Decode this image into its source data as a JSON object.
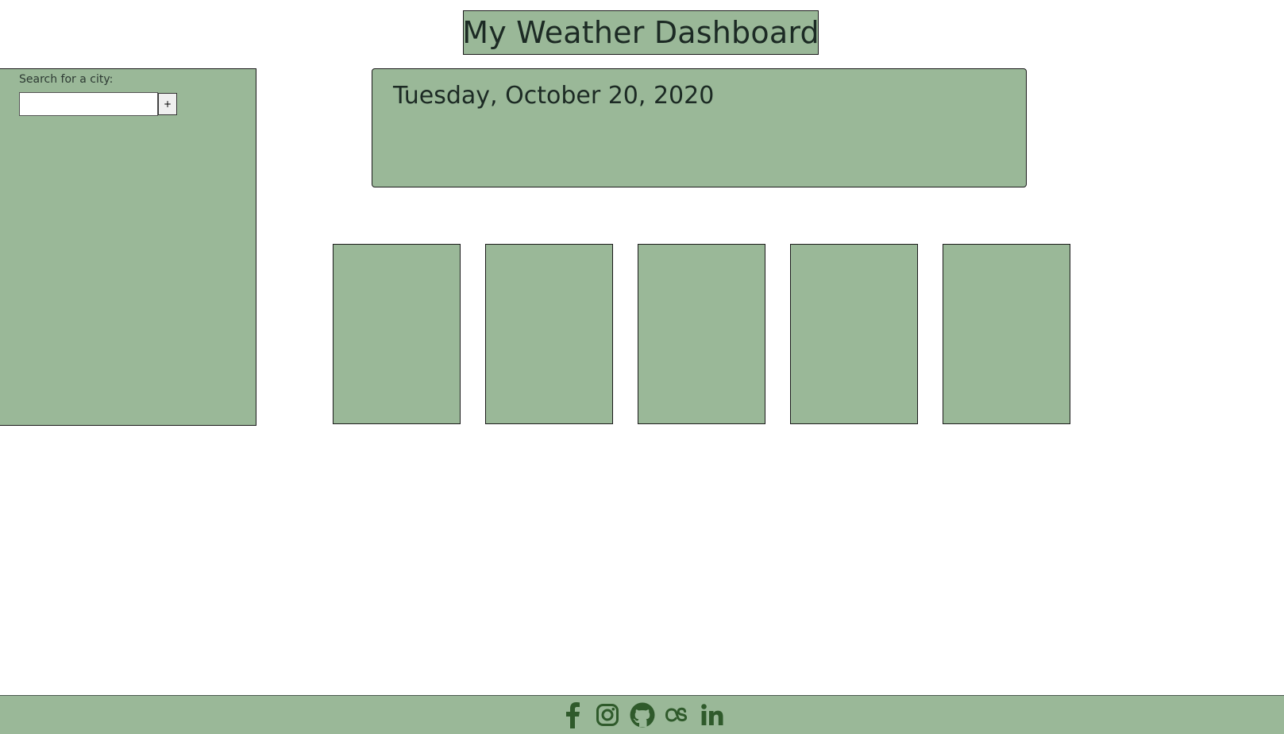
{
  "header": {
    "title": "My Weather Dashboard"
  },
  "sidebar": {
    "search_label": "Search for a city:",
    "search_value": "",
    "add_button_label": "+"
  },
  "current": {
    "date": "Tuesday, October 20, 2020"
  },
  "forecast": {
    "cards": [
      "",
      "",
      "",
      "",
      ""
    ]
  },
  "footer": {
    "social_icons": [
      "facebook-icon",
      "instagram-icon",
      "github-icon",
      "lastfm-icon",
      "linkedin-icon"
    ]
  },
  "colors": {
    "panel": "#9ab898",
    "icon": "#2f5a2b",
    "border": "#1b1b1b"
  }
}
